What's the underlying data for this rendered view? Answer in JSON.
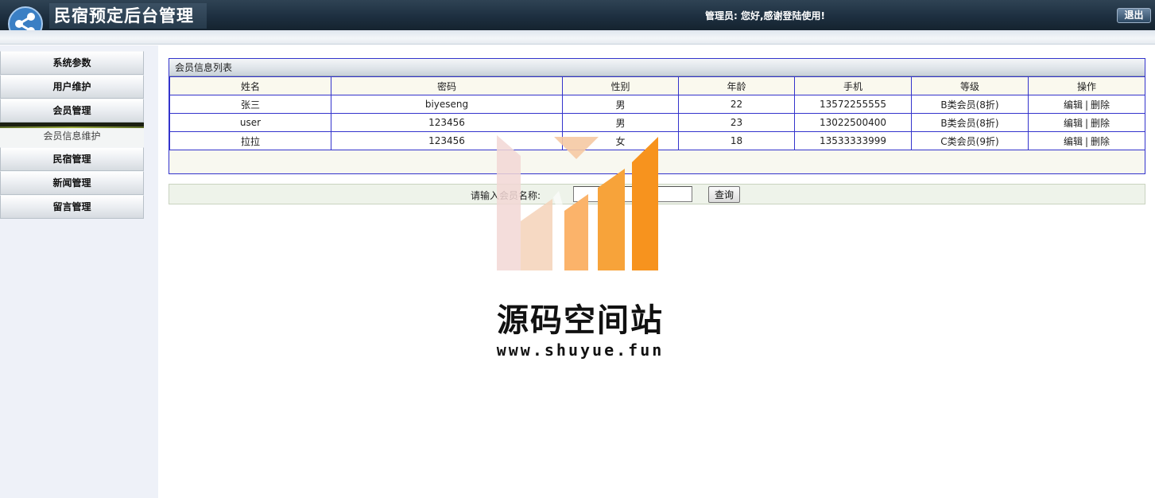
{
  "header": {
    "app_title": "民宿预定后台管理",
    "greeting": "管理员:  您好,感谢登陆使用!",
    "logout_label": "退出"
  },
  "sidebar": {
    "items": [
      {
        "label": "系统参数"
      },
      {
        "label": "用户维护"
      },
      {
        "label": "会员管理"
      },
      {
        "label": "民宿管理"
      },
      {
        "label": "新闻管理"
      },
      {
        "label": "留言管理"
      }
    ],
    "submenu": {
      "label": "会员信息维护"
    }
  },
  "panel": {
    "title": "会员信息列表",
    "columns": [
      "姓名",
      "密码",
      "性别",
      "年龄",
      "手机",
      "等级",
      "操作"
    ],
    "rows": [
      {
        "name": "张三",
        "password": "biyeseng",
        "gender": "男",
        "age": "22",
        "phone": "13572255555",
        "level": "B类会员(8折)"
      },
      {
        "name": "user",
        "password": "123456",
        "gender": "男",
        "age": "23",
        "phone": "13022500400",
        "level": "B类会员(8折)"
      },
      {
        "name": "拉拉",
        "password": "123456",
        "gender": "女",
        "age": "18",
        "phone": "13533333999",
        "level": "C类会员(9折)"
      }
    ],
    "edit_label": "编辑",
    "delete_label": "删除",
    "separator": "|"
  },
  "search": {
    "label": "请输入会员名称:",
    "input_value": "",
    "button_label": "查询"
  },
  "watermark": {
    "title": "源码空间站",
    "url": "www.shuyue.fun"
  },
  "colors": {
    "header_dark": "#1d2f40",
    "table_border": "#3333cc",
    "watermark_orange": "#f7931e"
  }
}
